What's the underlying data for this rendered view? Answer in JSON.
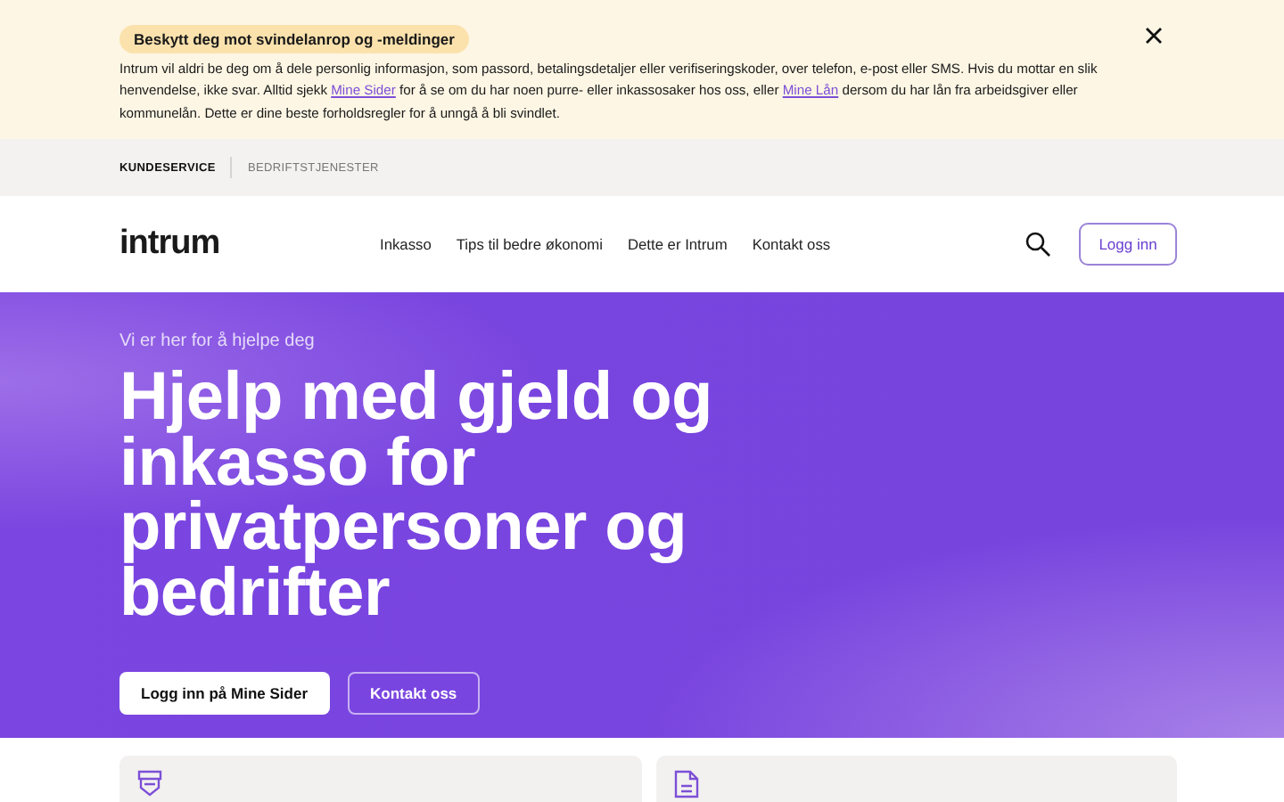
{
  "notice": {
    "title": "Beskytt deg mot svindelanrop og -meldinger",
    "parts": [
      {
        "kind": "text",
        "text": "Intrum vil aldri be deg om å dele personlig informasjon, som passord, betalingsdetaljer eller verifiseringskoder, over telefon, e-post eller SMS. Hvis du mottar en slik henvendelse, ikke svar. Alltid sjekk "
      },
      {
        "kind": "link",
        "text": "Mine Sider"
      },
      {
        "kind": "text",
        "text": " for å se om du har noen purre- eller inkassosaker hos oss, eller "
      },
      {
        "kind": "link",
        "text": "Mine Lån"
      },
      {
        "kind": "text",
        "text": " dersom du har lån fra arbeidsgiver eller kommunelån. Dette er dine beste forholdsregler for å unngå å bli svindlet."
      }
    ]
  },
  "segments": [
    {
      "label": "KUNDESERVICE",
      "selected": true
    },
    {
      "label": "BEDRIFTSTJENESTER",
      "selected": false
    }
  ],
  "header": {
    "logo": "intrum",
    "nav": [
      "Inkasso",
      "Tips til bedre økonomi",
      "Dette er Intrum",
      "Kontakt oss"
    ],
    "login": "Logg inn"
  },
  "hero": {
    "kicker": "Vi er her for å hjelpe deg",
    "title": "Hjelp med gjeld og inkasso for privatpersoner og bedrifter",
    "buttons": [
      {
        "kind": "primary",
        "label": "Logg inn på Mine Sider"
      },
      {
        "kind": "outline",
        "label": "Kontakt oss"
      }
    ]
  },
  "cards": [
    {
      "kind": "shield"
    },
    {
      "kind": "document"
    }
  ]
}
